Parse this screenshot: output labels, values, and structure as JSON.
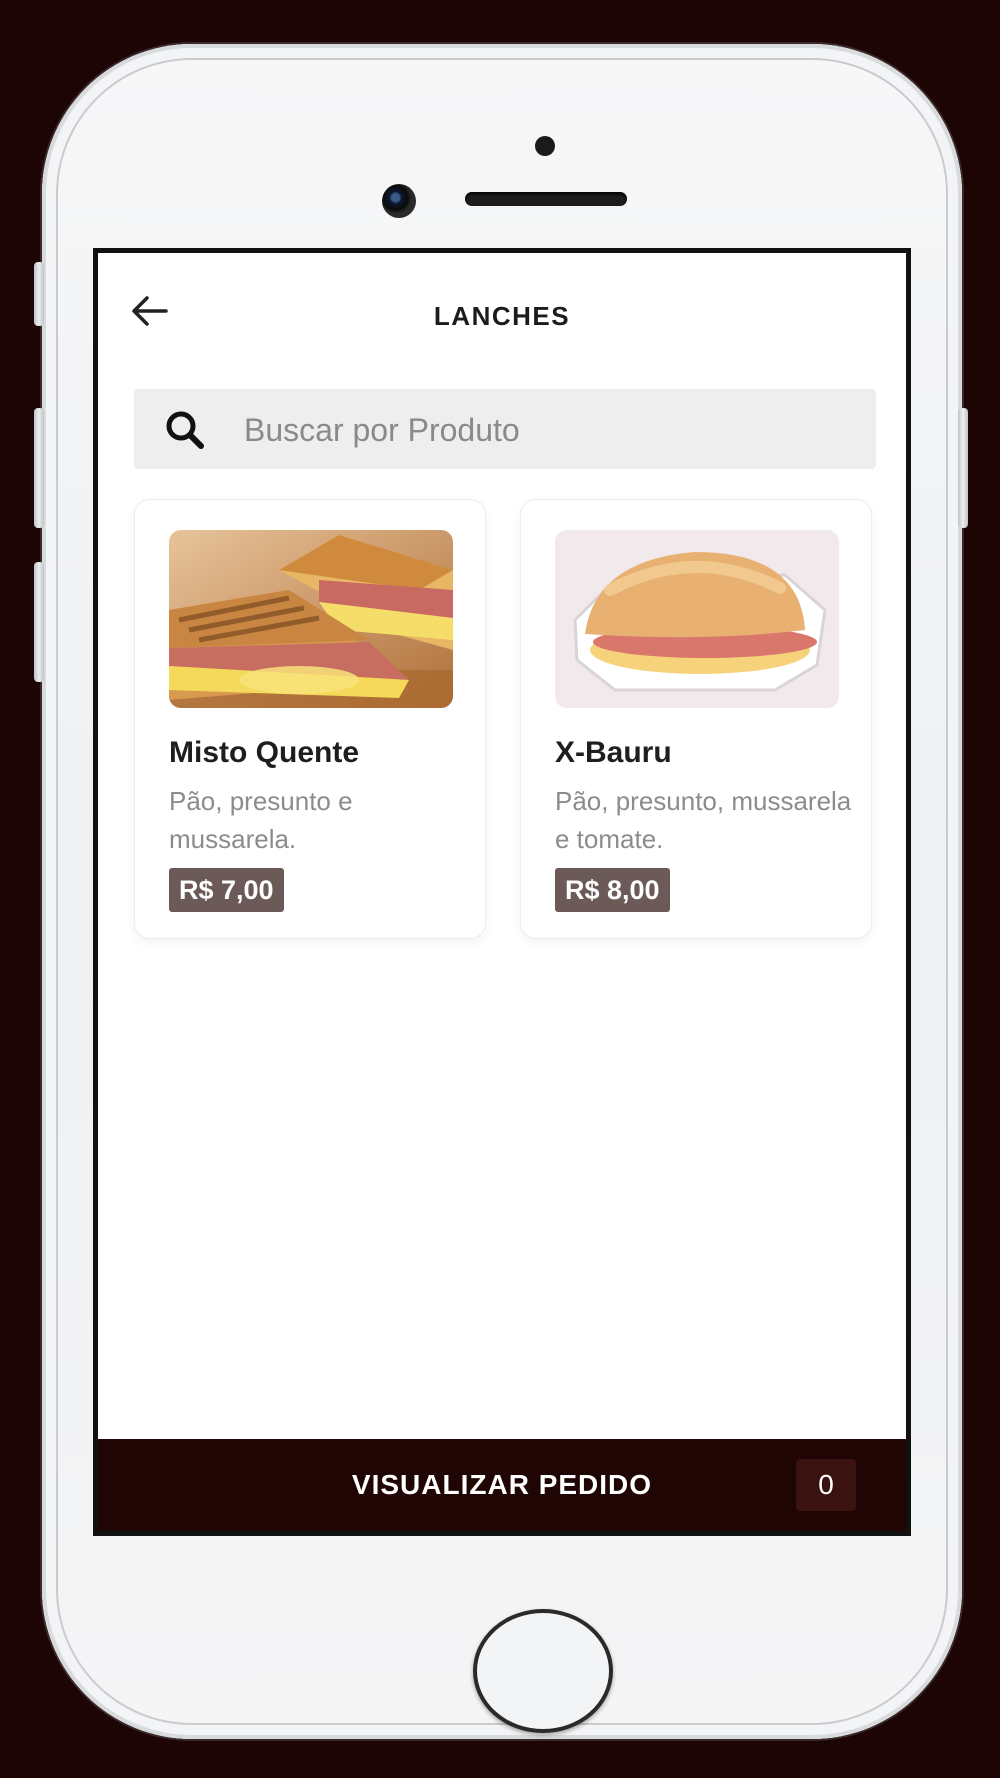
{
  "header": {
    "title": "LANCHES",
    "back_icon": "arrow-left-icon"
  },
  "search": {
    "placeholder": "Buscar por Produto",
    "value": "",
    "icon": "search-icon"
  },
  "products": [
    {
      "name": "Misto Quente",
      "description": "Pão, presunto e mussarela.",
      "price": "R$ 7,00"
    },
    {
      "name": "X-Bauru",
      "description": "Pão, presunto, mussarela e tomate.",
      "price": "R$ 8,00"
    }
  ],
  "footer": {
    "order_label": "VISUALIZAR PEDIDO",
    "order_count": "0"
  },
  "colors": {
    "background": "#1e0505",
    "footer": "#200505",
    "price_badge": "#6b5a58"
  }
}
